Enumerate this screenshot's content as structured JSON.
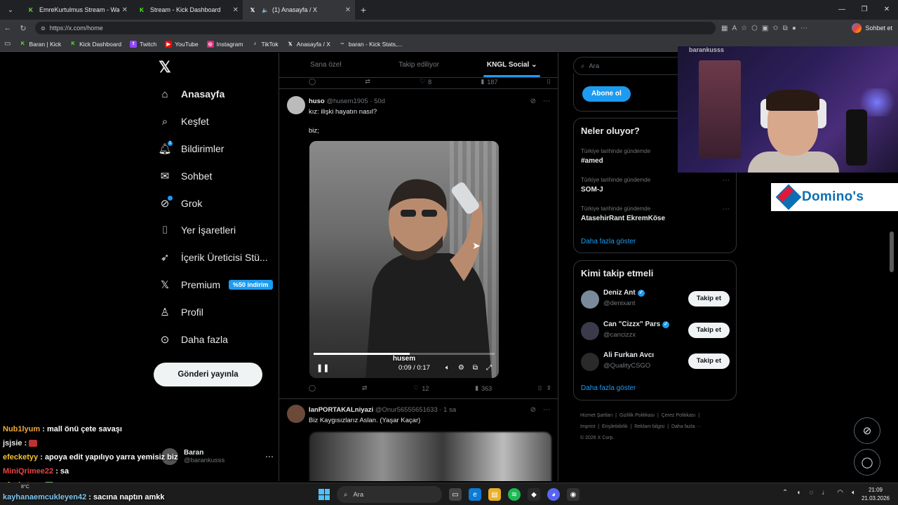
{
  "browser": {
    "tabs": [
      {
        "title": "EmreKurtulmus Stream - Watch Li",
        "favicon": "kick-icon"
      },
      {
        "title": "Stream - Kick Dashboard",
        "favicon": "kick-icon"
      },
      {
        "title": "(1) Anasayfa / X",
        "favicon": "x-icon",
        "active": true
      }
    ],
    "url": "https://x.com/home",
    "chat_button": "Sohbet et",
    "bookmarks": [
      {
        "label": "Baran | Kick",
        "icon": "kick-icon"
      },
      {
        "label": "Kick Dashboard",
        "icon": "kick-icon"
      },
      {
        "label": "Twitch",
        "icon": "twitch-icon"
      },
      {
        "label": "YouTube",
        "icon": "youtube-icon"
      },
      {
        "label": "Instagram",
        "icon": "instagram-icon"
      },
      {
        "label": "TikTok",
        "icon": "tiktok-icon"
      },
      {
        "label": "Anasayfa / X",
        "icon": "x-icon"
      },
      {
        "label": "baran - Kick Stats,...",
        "icon": "stats-icon"
      }
    ]
  },
  "nav": {
    "items": [
      {
        "label": "Anasayfa",
        "icon": "home-icon"
      },
      {
        "label": "Keşfet",
        "icon": "search-icon"
      },
      {
        "label": "Bildirimler",
        "icon": "bell-icon",
        "badge": "1"
      },
      {
        "label": "Sohbet",
        "icon": "mail-icon"
      },
      {
        "label": "Grok",
        "icon": "grok-icon"
      },
      {
        "label": "Yer İşaretleri",
        "icon": "bookmark-icon"
      },
      {
        "label": "İçerik Üreticisi Stü...",
        "icon": "rocket-icon"
      },
      {
        "label": "Premium",
        "icon": "x-icon",
        "badge": "%50 indirim"
      },
      {
        "label": "Profil",
        "icon": "person-icon"
      },
      {
        "label": "Daha fazla",
        "icon": "more-circle-icon"
      }
    ],
    "post_button": "Gönderi yayınla",
    "account": {
      "name": "Baran",
      "handle": "@barankusss"
    }
  },
  "feed": {
    "tabs": [
      "Sana özel",
      "Takip ediliyor",
      "KNGL Social"
    ],
    "prev_actions": {
      "likes": "8",
      "views": "187"
    },
    "tweet1": {
      "name": "huso",
      "handle": "@husem1905 · 50d",
      "line1": "kız: ilişki hayatın nasıl?",
      "line2": "biz;",
      "video": {
        "caption": "husem",
        "time": "0:09 / 0:17",
        "progress": 0.53
      },
      "actions": {
        "replies": "",
        "reposts": "",
        "likes": "12",
        "views": "363"
      }
    },
    "tweet2": {
      "name": "IanPORTAKALniyazi",
      "handle": "@Onur56555651633 · 1 sa",
      "text": "Biz Kaygısızlarız Aslan. (Yaşar Kaçar)"
    }
  },
  "sidebar": {
    "search_placeholder": "Ara",
    "subscribe": "Abone ol",
    "trends_title": "Neler oluyor?",
    "trends": [
      {
        "meta": "Türkiye tarihinde gündemde",
        "topic": "#amed"
      },
      {
        "meta": "Türkiye tarihinde gündemde",
        "topic": "SOM-J"
      },
      {
        "meta": "Türkiye tarihinde gündemde",
        "topic": "AtasehirRant EkremKöse"
      }
    ],
    "show_more": "Daha fazla göster",
    "who_title": "Kimi takip etmeli",
    "who": [
      {
        "name": "Deniz Ant",
        "handle": "@denixant",
        "verified": true,
        "button": "Takip et"
      },
      {
        "name": "Can \"Cizzx\" Pars",
        "handle": "@cancizzx",
        "verified": true,
        "button": "Takip et"
      },
      {
        "name": "Ali Furkan Avcı",
        "handle": "@QualityCSGO",
        "verified": false,
        "button": "Takip et"
      }
    ],
    "footer": [
      "Hizmet Şartları",
      "Gizlilik Politikası",
      "Çerez Politikası",
      "Imprint",
      "Erişilebilirlik",
      "Reklam bilgisi",
      "Daha fazla ···",
      "© 2026 X Corp."
    ]
  },
  "overlay": {
    "webcam_handle": "barankusss",
    "sponsor": "Domino's",
    "chat": [
      {
        "user": "Nub1lyum",
        "text": "mall önü çete savaşı"
      },
      {
        "user": "jsjsie",
        "text": ""
      },
      {
        "user": "efecketyy",
        "text": "apoya edit yapılıyo yarra yemisiz biz"
      },
      {
        "user": "MiniQrimee22",
        "text": "sa"
      },
      {
        "user": "efecketyy",
        "text": ""
      },
      {
        "user": "kayhanaemcukleyen42",
        "text": "sacına naptın amkk"
      }
    ]
  },
  "taskbar": {
    "weather": "8°C",
    "search": "Ara",
    "time": "21:09",
    "date": "21.03.2026"
  }
}
